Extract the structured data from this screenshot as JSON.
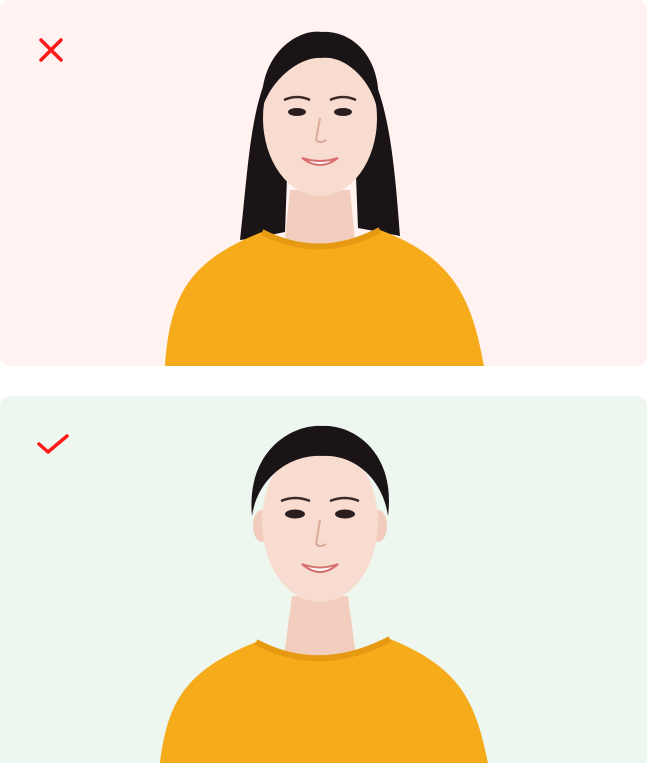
{
  "examples": [
    {
      "status": "incorrect",
      "mark_icon": "cross-icon",
      "hair": "loose-long",
      "colors": {
        "background": "#fff2f1",
        "mark": "#ff1a1a",
        "shirt": "#f6ab1a",
        "hair": "#1b1416",
        "skin": "#f7dccf"
      }
    },
    {
      "status": "correct",
      "mark_icon": "check-icon",
      "hair": "tied-back",
      "colors": {
        "background": "#edf6ef",
        "mark": "#ff1a1a",
        "shirt": "#f6ab1a",
        "hair": "#1b1416",
        "skin": "#f7dccf"
      }
    }
  ]
}
